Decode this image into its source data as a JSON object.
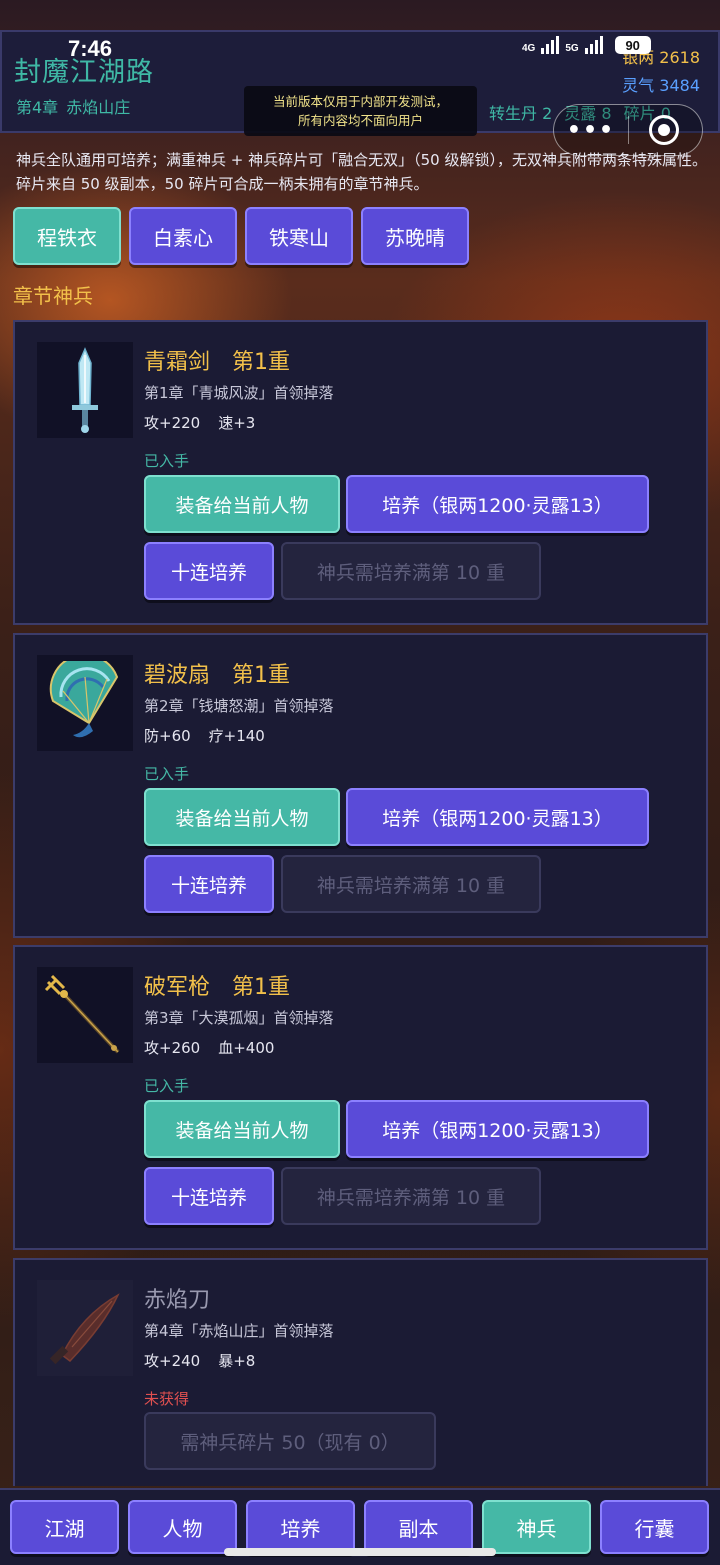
{
  "status": {
    "time": "7:46",
    "net1": "4G",
    "net2": "5G",
    "battery": "90"
  },
  "header": {
    "title": "封魔江湖路",
    "chapter": "第4章",
    "chapter_name": "赤焰山庄",
    "silver_label": "银两",
    "silver_value": "2618",
    "qi_label": "灵气",
    "qi_value": "3484",
    "rebirth_label": "转生丹",
    "rebirth_value": "2",
    "dew_label": "灵露",
    "dew_value": "8",
    "frag_label": "碎片",
    "frag_value": "0"
  },
  "dev_notice": {
    "line1": "当前版本仅用于内部开发测试，",
    "line2": "所有内容均不面向用户"
  },
  "capsule": {
    "more": "•••"
  },
  "description": "神兵全队通用可培养；满重神兵 + 神兵碎片可「融合无双」（50 级解锁），无双神兵附带两条特殊属性。碎片来自 50 级副本，50 碎片可合成一柄未拥有的章节神兵。",
  "characters": [
    "程铁衣",
    "白素心",
    "铁寒山",
    "苏晚晴"
  ],
  "section_title": "章节神兵",
  "weapons": [
    {
      "name": "青霜剑",
      "tier": "第1重",
      "source": "第1章「青城风波」首领掉落",
      "stat1": "攻+220",
      "stat2": "速+3",
      "state": "已入手",
      "equip": "装备给当前人物",
      "train": "培养（银两1200·灵露13）",
      "ten": "十连培养",
      "need": "神兵需培养满第 10 重",
      "icon": "sword-icon"
    },
    {
      "name": "碧波扇",
      "tier": "第1重",
      "source": "第2章「钱塘怒潮」首领掉落",
      "stat1": "防+60",
      "stat2": "疗+140",
      "state": "已入手",
      "equip": "装备给当前人物",
      "train": "培养（银两1200·灵露13）",
      "ten": "十连培养",
      "need": "神兵需培养满第 10 重",
      "icon": "fan-icon"
    },
    {
      "name": "破军枪",
      "tier": "第1重",
      "source": "第3章「大漠孤烟」首领掉落",
      "stat1": "攻+260",
      "stat2": "血+400",
      "state": "已入手",
      "equip": "装备给当前人物",
      "train": "培养（银两1200·灵露13）",
      "ten": "十连培养",
      "need": "神兵需培养满第 10 重",
      "icon": "spear-icon"
    },
    {
      "name": "赤焰刀",
      "tier": "",
      "source": "第4章「赤焰山庄」首领掉落",
      "stat1": "攻+240",
      "stat2": "暴+8",
      "state": "未获得",
      "fragments": "需神兵碎片 50（现有 0）",
      "icon": "blade-icon"
    }
  ],
  "nav": [
    "江湖",
    "人物",
    "培养",
    "副本",
    "神兵",
    "行囊"
  ],
  "nav_active": "神兵",
  "colors": {
    "teal": "#45b8a6",
    "purple": "#5a4bd8",
    "gold": "#f2c04a",
    "panel": "#1b1b34"
  }
}
